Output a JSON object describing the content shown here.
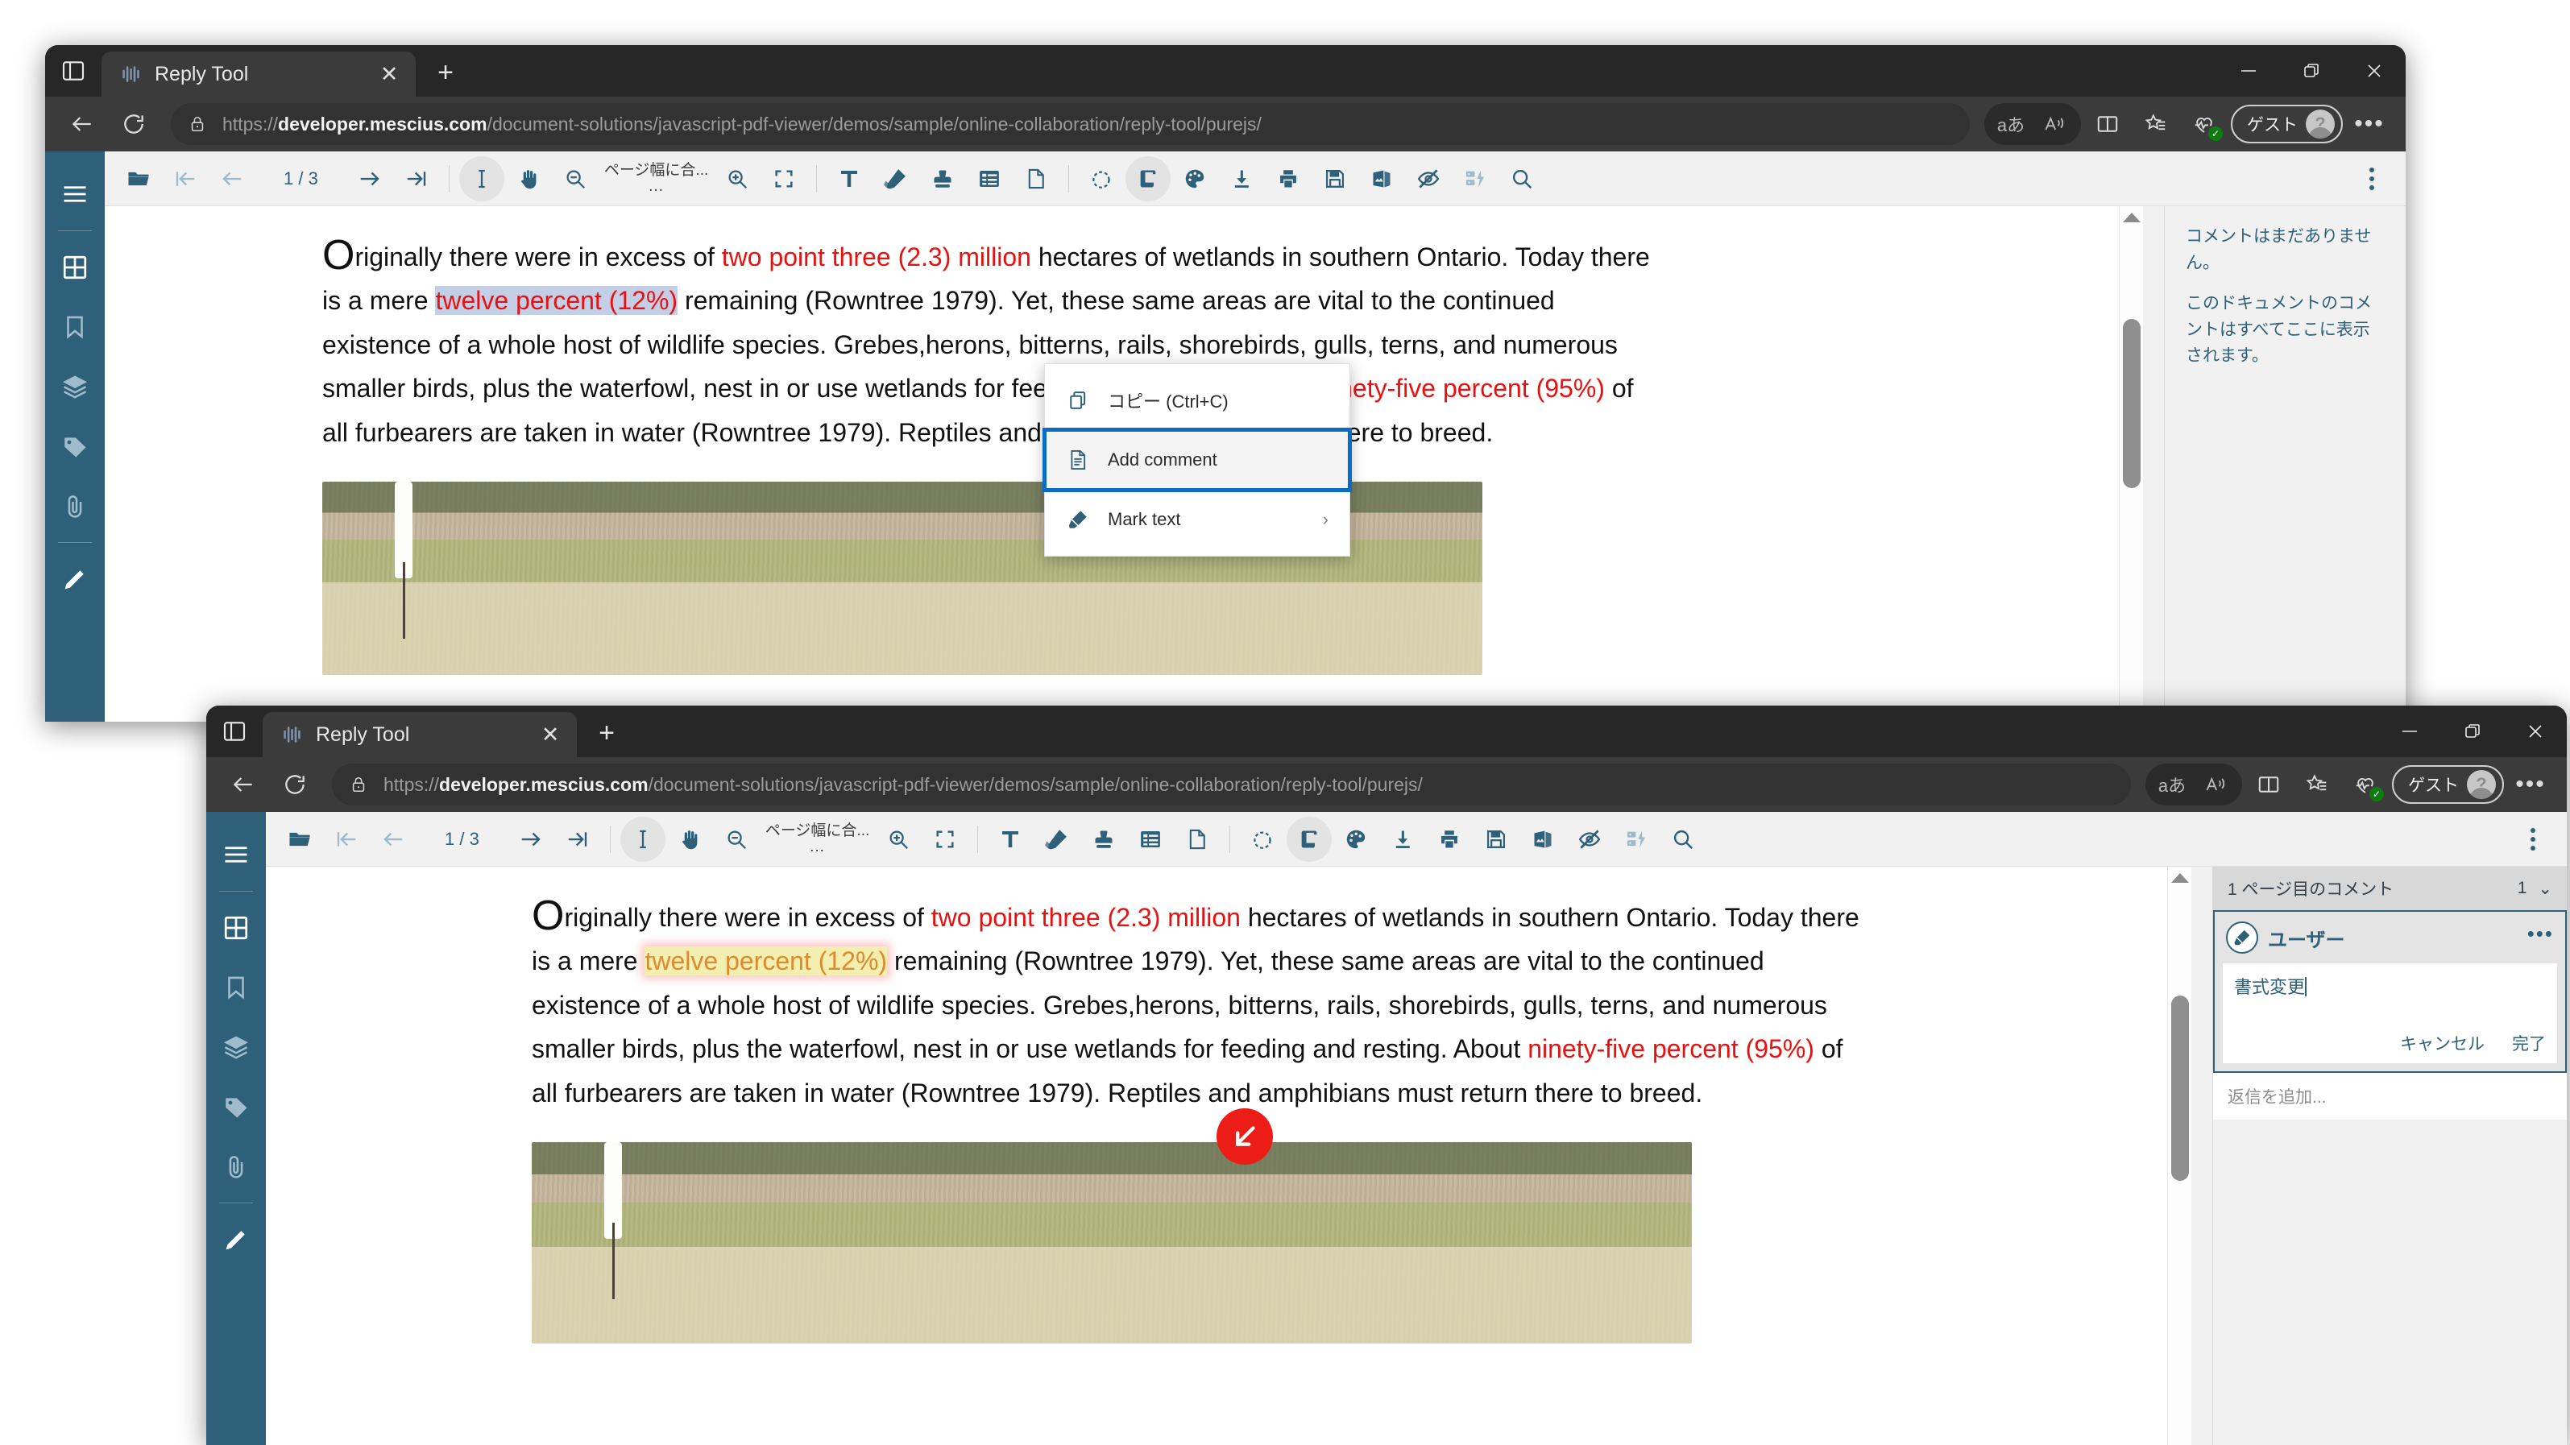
{
  "browser": {
    "tab_title": "Reply Tool",
    "url_scheme": "https://",
    "url_domain": "developer.mescius.com",
    "url_path": "/document-solutions/javascript-pdf-viewer/demos/sample/online-collaboration/reply-tool/purejs/",
    "profile_label": "ゲスト",
    "icons": {
      "tab_search": "tab-search-icon",
      "favicon": "mescius-favicon",
      "close": "close-icon",
      "newtab": "new-tab-icon",
      "minimize": "minimize-icon",
      "maximize": "restore-icon",
      "window_close": "window-close-icon",
      "back": "back-arrow-icon",
      "reload": "reload-icon",
      "lock": "lock-icon",
      "translate": "translate-icon",
      "read_aloud": "read-aloud-icon",
      "split_screen": "split-screen-icon",
      "collections": "collections-icon",
      "browser_essentials": "browser-essentials-icon",
      "settings": "more-options-icon"
    }
  },
  "viewer": {
    "sidebar_items": [
      {
        "name": "menu-icon",
        "label": "メニュー"
      },
      {
        "name": "thumbnails-icon",
        "label": "サムネイル"
      },
      {
        "name": "bookmark-icon",
        "label": "ブックマーク"
      },
      {
        "name": "layers-icon",
        "label": "レイヤー"
      },
      {
        "name": "tag-icon",
        "label": "タグ"
      },
      {
        "name": "attachment-icon",
        "label": "添付ファイル"
      },
      {
        "name": "edit-icon",
        "label": "編集"
      }
    ],
    "toolbar": {
      "page_indicator": "1 / 3",
      "zoom_label": "ページ幅に合...",
      "zoom_label_more": "...",
      "buttons": [
        "open-file-icon",
        "first-page-icon",
        "previous-page-icon",
        "next-page-icon",
        "last-page-icon",
        "text-select-icon",
        "pan-tool-icon",
        "zoom-out-icon",
        "zoom-in-icon",
        "fullscreen-icon",
        "add-text-icon",
        "annotate-icon",
        "stamp-icon",
        "form-fields-icon",
        "page-tools-icon",
        "rotate-icon",
        "scroll-mode-icon",
        "theme-icon",
        "download-icon",
        "print-icon",
        "save-icon",
        "export-image-icon",
        "hide-annotations-icon",
        "split-view-icon",
        "search-icon",
        "more-options-icon"
      ]
    }
  },
  "document": {
    "para": {
      "dropcap": "O",
      "s1": "riginally there were in excess of ",
      "r1": "two point three (2.3) million",
      "s2": " hectares of wetlands in southern Ontario. Today there is a mere ",
      "hl": "twelve percent (12%)",
      "s3": " remaining (Rowntree 1979). Yet, these same areas are vital to the continued existence of a whole host of wildlife species. Grebes,herons, bitterns, rails, shorebirds, gulls, terns, and numerous smaller birds, plus the waterfowl, nest in or use wetlands for feeding and resting. About ",
      "r2": "ninety-five percent (95%)",
      "s4": " of all furbearers are taken in water (Rowntree 1979). Reptiles and amphibians must return there to breed."
    },
    "image_alt": "wetland-marsh-photo"
  },
  "context_menu": {
    "items": [
      {
        "label": "コピー (Ctrl+C)",
        "icon": "copy-icon",
        "selected": false,
        "submenu": false
      },
      {
        "label": "Add comment",
        "icon": "add-comment-icon",
        "selected": true,
        "submenu": false
      },
      {
        "label": "Mark text",
        "icon": "highlighter-icon",
        "selected": false,
        "submenu": true
      }
    ],
    "submenu_chevron": "›"
  },
  "comments_empty": {
    "title": "コメントはまだありません。",
    "body": "このドキュメントのコメントはすべてここに表示されます。"
  },
  "comments_panel": {
    "header_label": "1 ページ目のコメント",
    "header_count": "1",
    "header_chevron": "⌄",
    "author": "ユーザー",
    "avatar_icon": "highlighter-avatar-icon",
    "kebab": "•••",
    "input_value": "書式変更",
    "cancel_label": "キャンセル",
    "done_label": "完了",
    "reply_placeholder": "返信を追加..."
  },
  "cursor": {
    "name": "cursor-indicator",
    "glyph": "↙"
  },
  "colors": {
    "accent": "#2f6079",
    "sidebar": "#2f6079",
    "red_text": "#e8110f",
    "selection_blue": "#c3cfe6",
    "highlight_yellow": "#f2efb0",
    "menu_focus_blue": "#0a6cc4",
    "cursor_red": "#ec1c17"
  }
}
